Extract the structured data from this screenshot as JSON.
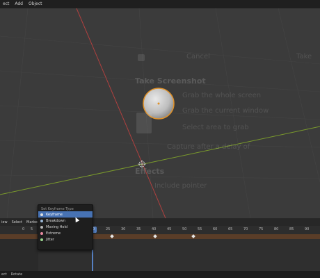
{
  "topbar": {
    "items": [
      "ect",
      "Add",
      "Object"
    ]
  },
  "overlay": {
    "cancel": "Cancel",
    "take_right": "Take",
    "title": "Take Screenshot",
    "grab_screen": "Grab the whole screen",
    "grab_window": "Grab the current window",
    "select_area": "Select area to grab",
    "capture_after": "Capture after a delay of",
    "effects": "Effects",
    "include_pointer": "Include pointer"
  },
  "timeline": {
    "header_items": [
      "iew",
      "Select",
      "Marker"
    ],
    "ruler_left": [
      "0",
      "5"
    ],
    "ruler_ticks": [
      "25",
      "30",
      "35",
      "40",
      "45",
      "50",
      "55",
      "60",
      "65",
      "70",
      "75",
      "80",
      "85",
      "90"
    ],
    "current_frame": "20"
  },
  "menu": {
    "title": "Set Keyframe Type",
    "items": [
      {
        "label": "Keyframe",
        "color": "#e0e0e0",
        "shortcut": "",
        "active": true
      },
      {
        "label": "Breakdown",
        "color": "#9ab7d6",
        "shortcut": "",
        "active": false
      },
      {
        "label": "Moving Hold",
        "color": "#b8b8b8",
        "shortcut": "",
        "active": false
      },
      {
        "label": "Extreme",
        "color": "#e88aa0",
        "shortcut": "",
        "active": false
      },
      {
        "label": "Jitter",
        "color": "#9ad68e",
        "shortcut": "",
        "active": false
      }
    ]
  },
  "bottombar": {
    "items": [
      "ect",
      "Rotate"
    ]
  },
  "colors": {
    "sphere_outline": "#e0922a",
    "x_axis": "#b0403f",
    "y_axis": "#7a9a2c",
    "active_item": "#4772b3"
  }
}
